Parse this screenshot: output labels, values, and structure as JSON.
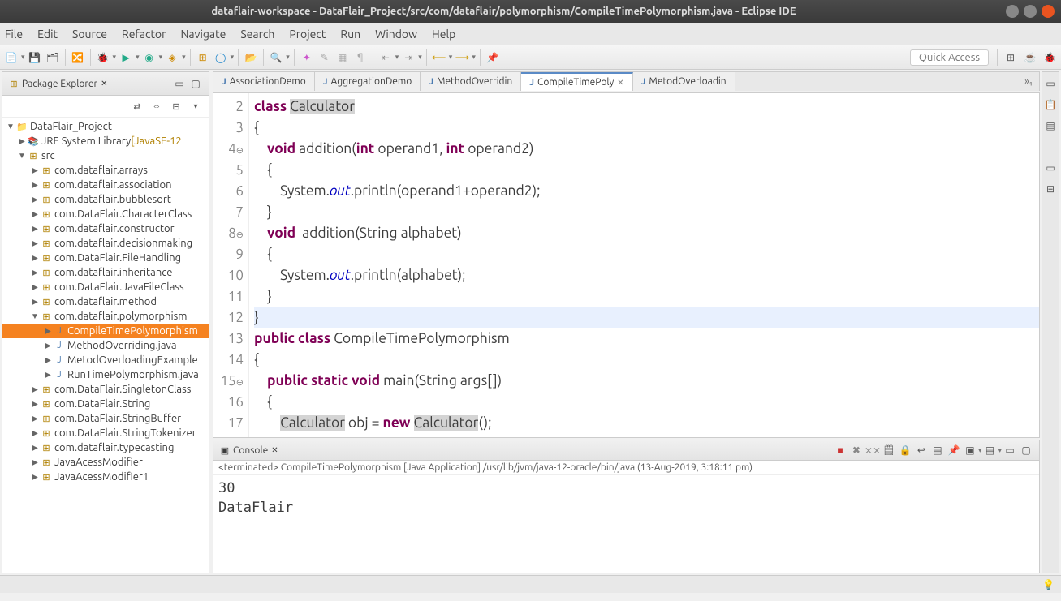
{
  "window": {
    "title": "dataflair-workspace - DataFlair_Project/src/com/dataflair/polymorphism/CompileTimePolymorphism.java - Eclipse IDE"
  },
  "menu": [
    "File",
    "Edit",
    "Source",
    "Refactor",
    "Navigate",
    "Search",
    "Project",
    "Run",
    "Window",
    "Help"
  ],
  "quick_access": "Quick Access",
  "package_explorer": {
    "title": "Package Explorer",
    "project": "DataFlair_Project",
    "jre": "JRE System Library",
    "jre_ver": "[JavaSE-12",
    "src": "src",
    "packages": [
      "com.dataflair.arrays",
      "com.dataflair.association",
      "com.dataflair.bubblesort",
      "com.DataFlair.CharacterClass",
      "com.dataflair.constructor",
      "com.dataflair.decisionmaking",
      "com.DataFlair.FileHandling",
      "com.dataflair.inheritance",
      "com.DataFlair.JavaFileClass",
      "com.dataflair.method"
    ],
    "open_pkg": "com.dataflair.polymorphism",
    "files": [
      "CompileTimePolymorphism",
      "MethodOverriding.java",
      "MetodOverloadingExample",
      "RunTimePolymorphism.java"
    ],
    "packages2": [
      "com.DataFlair.SingletonClass",
      "com.DataFlair.String",
      "com.DataFlair.StringBuffer",
      "com.DataFlair.StringTokenizer",
      "com.dataflair.typecasting",
      "JavaAcessModifier",
      "JavaAcessModifier1"
    ]
  },
  "editor_tabs": [
    {
      "label": "AssociationDemo"
    },
    {
      "label": "AggregationDemo"
    },
    {
      "label": "MethodOverridin"
    },
    {
      "label": "CompileTimePoly",
      "active": true
    },
    {
      "label": "MetodOverloadin"
    }
  ],
  "more_tabs": "»₁",
  "code_lines": [
    {
      "n": "2",
      "html": "<span class='kw'>class</span> <span class='hlspan'>Calculator</span>"
    },
    {
      "n": "3",
      "html": "{"
    },
    {
      "n": "4",
      "fold": true,
      "html": "    <span class='kw'>void</span> addition(<span class='kw'>int</span> operand1, <span class='kw'>int</span> operand2)"
    },
    {
      "n": "5",
      "html": "    {"
    },
    {
      "n": "6",
      "html": "        System.<span class='it'>out</span>.println(operand1+operand2);"
    },
    {
      "n": "7",
      "html": "    }"
    },
    {
      "n": "8",
      "fold": true,
      "html": "    <span class='kw'>void</span>  addition(String alphabet)"
    },
    {
      "n": "9",
      "html": "    {"
    },
    {
      "n": "10",
      "html": "        System.<span class='it'>out</span>.println(alphabet);"
    },
    {
      "n": "11",
      "html": "    }"
    },
    {
      "n": "12",
      "hl": true,
      "html": "}"
    },
    {
      "n": "13",
      "html": "<span class='kw'>public</span> <span class='kw'>class</span> CompileTimePolymorphism"
    },
    {
      "n": "14",
      "html": "{"
    },
    {
      "n": "15",
      "fold": true,
      "html": "    <span class='kw'>public</span> <span class='kw'>static</span> <span class='kw'>void</span> main(String args[])"
    },
    {
      "n": "16",
      "html": "    {"
    },
    {
      "n": "17",
      "html": "        <span class='hlspan'>Calculator</span> obj = <span class='kw'>new</span> <span class='hlspan'>Calculator</span>();"
    }
  ],
  "console": {
    "title": "Console",
    "info": "<terminated> CompileTimePolymorphism [Java Application] /usr/lib/jvm/java-12-oracle/bin/java (13-Aug-2019, 3:18:11 pm)",
    "output": "30\nDataFlair"
  }
}
